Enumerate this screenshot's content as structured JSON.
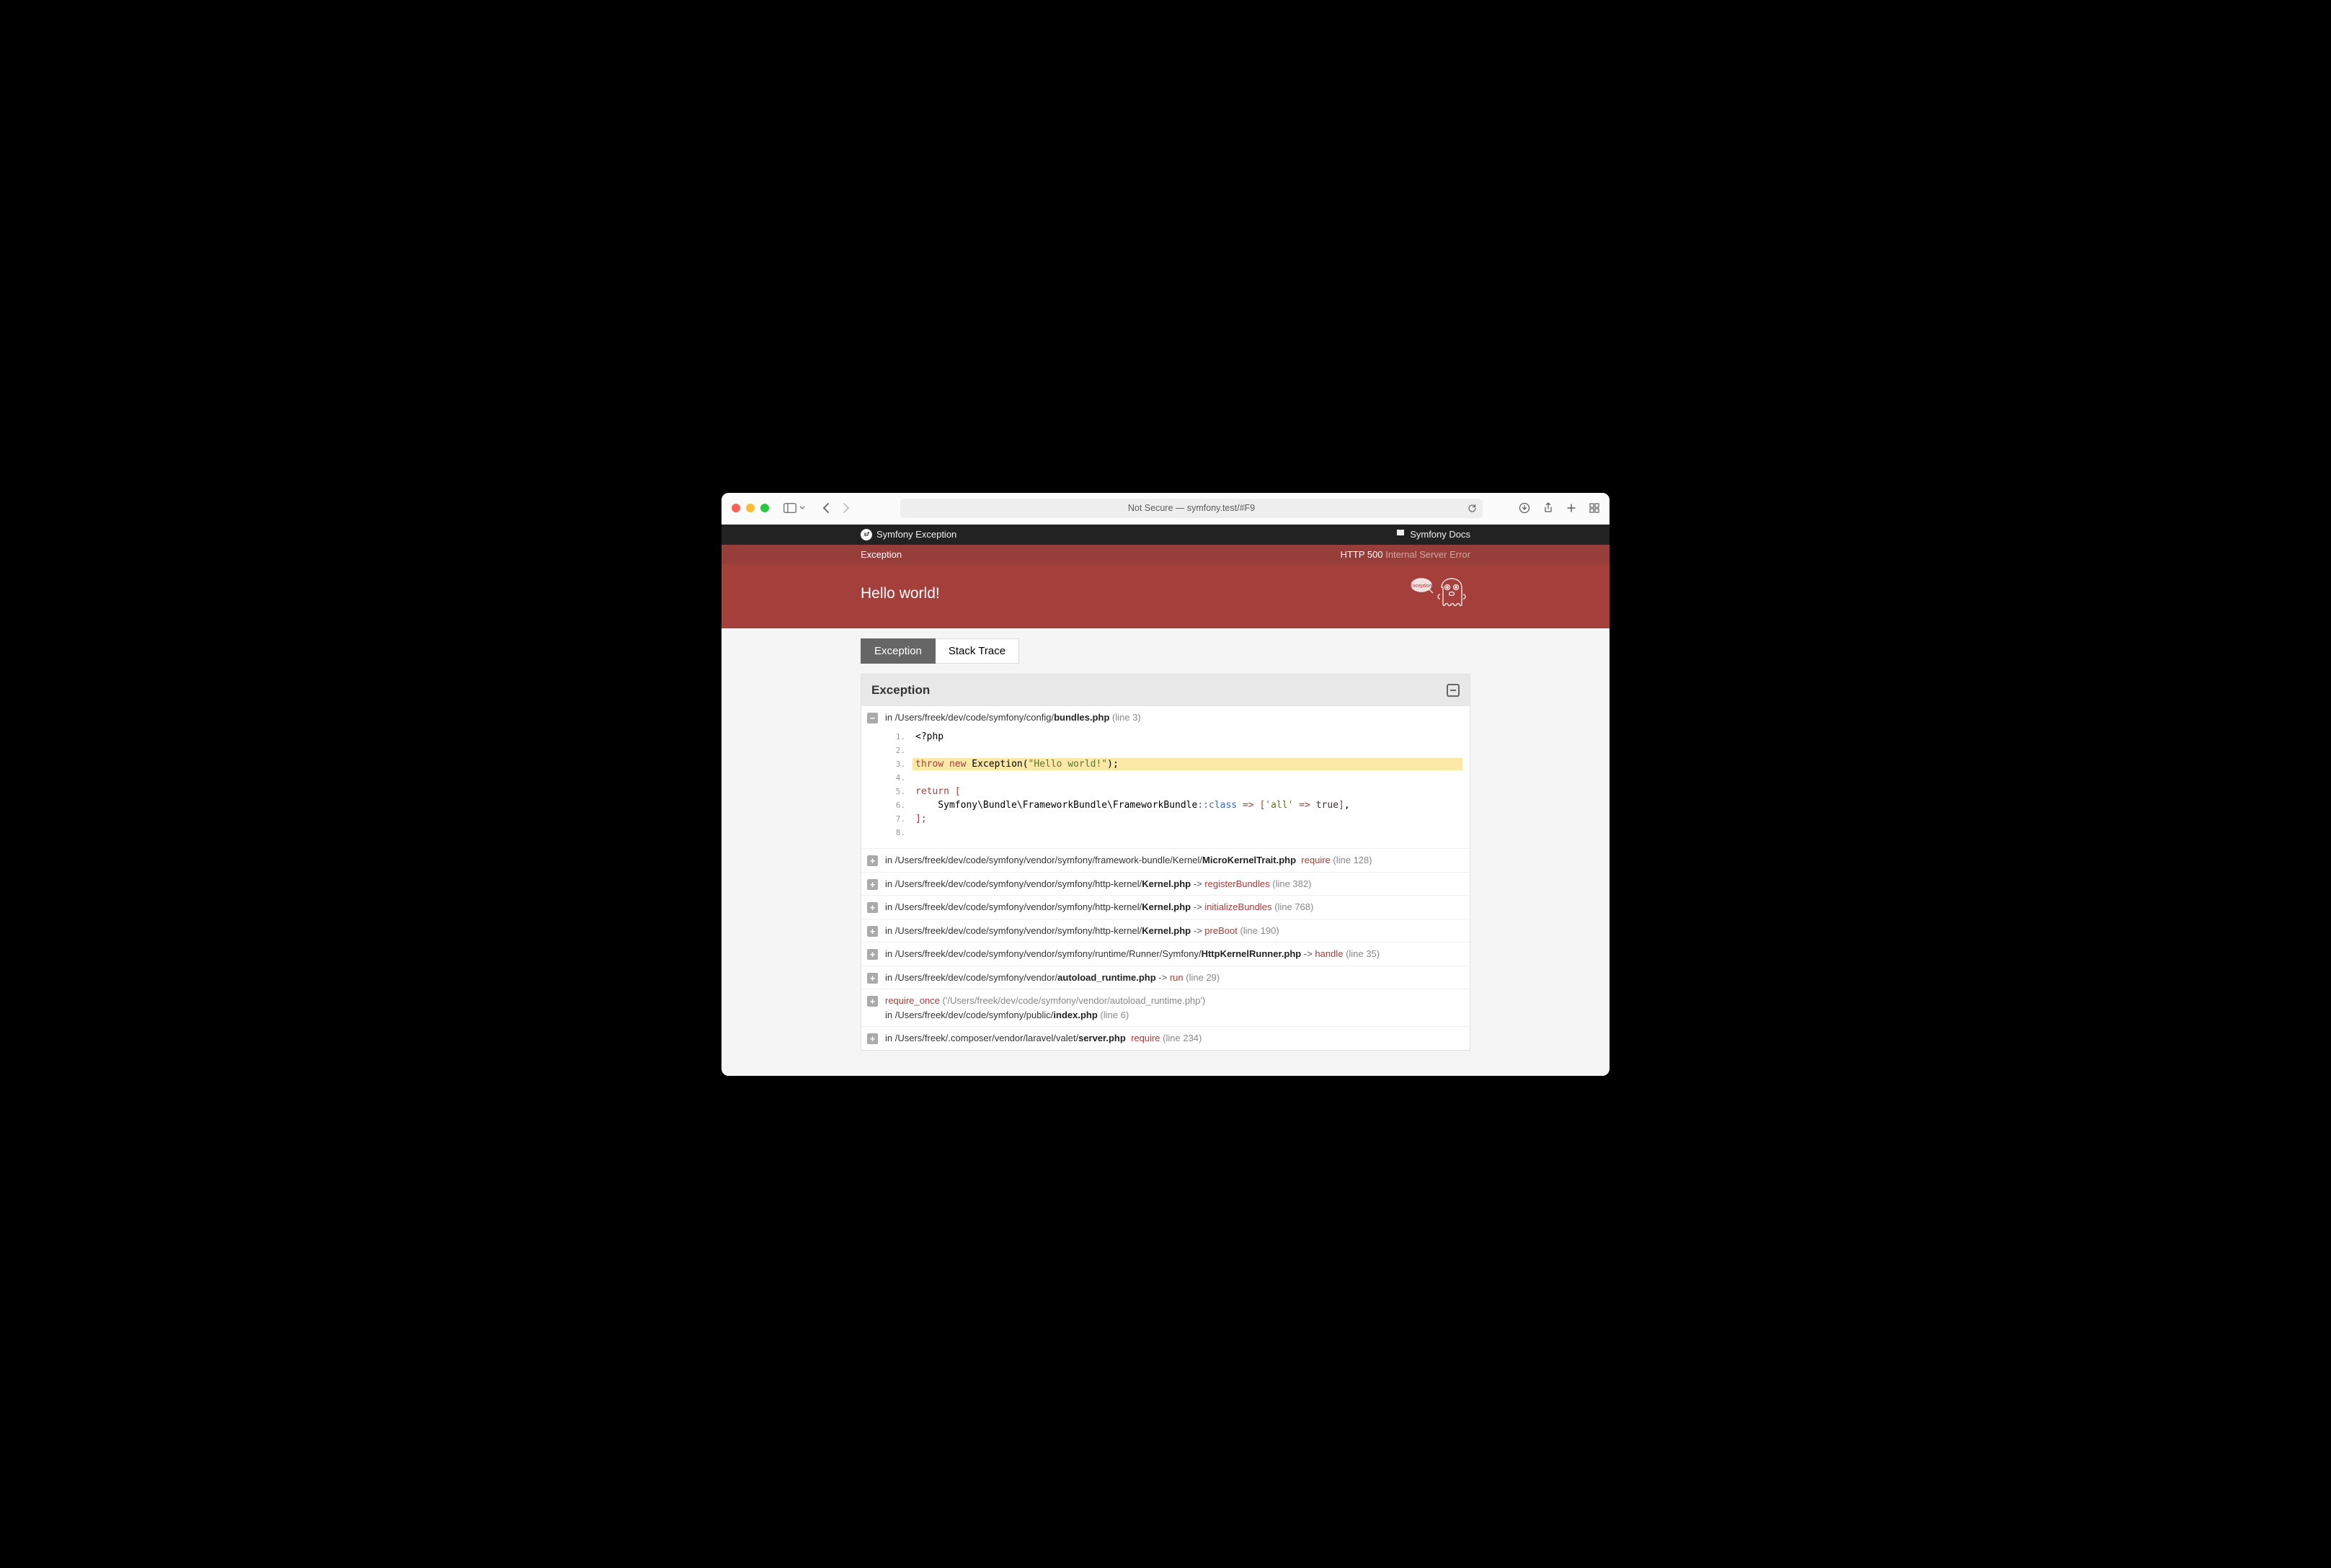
{
  "browser": {
    "addr_prefix": "Not Secure — ",
    "addr": "symfony.test/#F9"
  },
  "topbar": {
    "title": "Symfony Exception",
    "docs": "Symfony Docs"
  },
  "errstrip": {
    "exception": "Exception",
    "http": "HTTP 500",
    "status": "Internal Server Error"
  },
  "hero": {
    "message": "Hello world!"
  },
  "tabs": {
    "exception": "Exception",
    "stack": "Stack Trace"
  },
  "panel": {
    "title": "Exception"
  },
  "frames": [
    {
      "expanded": true,
      "in": "in ",
      "path": "/Users/freek/dev/code/symfony/config/",
      "file": "bundles.php",
      "lineno": "(line 3)",
      "code": {
        "start": 1,
        "lines": [
          {
            "html": "<span>&lt;?php</span>"
          },
          {
            "html": ""
          },
          {
            "hl": true,
            "html": "<span class='k-kw'>throw</span> <span class='k-kw'>new</span> Exception(<span class='k-str'>\"Hello world!\"</span>);"
          },
          {
            "html": ""
          },
          {
            "html": "<span class='k-kw'>return</span> <span class='k-punc'>[</span>"
          },
          {
            "html": "    Symfony\\Bundle\\FrameworkBundle\\FrameworkBundle<span class='k-class'>::class</span> <span class='k-punc'>=&gt;</span> <span class='k-punc'>[</span><span class='k-str'>'all'</span> <span class='k-punc'>=&gt;</span> <span class='k-bool'>true</span><span class='k-punc'>]</span>,"
          },
          {
            "html": "<span class='k-punc'>];</span>"
          },
          {
            "html": ""
          }
        ]
      }
    },
    {
      "in": "in ",
      "path": "/Users/freek/dev/code/symfony/vendor/symfony/framework-bundle/Kernel/",
      "file": "MicroKernelTrait.php",
      "method": "require",
      "lineno": "(line 128)"
    },
    {
      "in": "in ",
      "path": "/Users/freek/dev/code/symfony/vendor/symfony/http-kernel/",
      "file": "Kernel.php",
      "arrow": " -> ",
      "method": "registerBundles",
      "lineno": "(line 382)"
    },
    {
      "in": "in ",
      "path": "/Users/freek/dev/code/symfony/vendor/symfony/http-kernel/",
      "file": "Kernel.php",
      "arrow": " -> ",
      "method": "initializeBundles",
      "lineno": "(line 768)"
    },
    {
      "in": "in ",
      "path": "/Users/freek/dev/code/symfony/vendor/symfony/http-kernel/",
      "file": "Kernel.php",
      "arrow": " -> ",
      "method": "preBoot",
      "lineno": "(line 190)"
    },
    {
      "in": "in ",
      "path": "/Users/freek/dev/code/symfony/vendor/symfony/runtime/Runner/Symfony/",
      "file": "HttpKernelRunner.php",
      "arrow": " -> ",
      "method": "handle",
      "lineno": "(line 35)"
    },
    {
      "in": "in ",
      "path": "/Users/freek/dev/code/symfony/vendor/",
      "file": "autoload_runtime.php",
      "arrow": " -> ",
      "method": "run",
      "lineno": "(line 29)"
    },
    {
      "topmethod": "require_once",
      "topargs": "('/Users/freek/dev/code/symfony/vendor/autoload_runtime.php')",
      "in": "in ",
      "path": "/Users/freek/dev/code/symfony/public/",
      "file": "index.php",
      "lineno": "(line 6)"
    },
    {
      "in": "in ",
      "path": "/Users/freek/.composer/vendor/laravel/valet/",
      "file": "server.php",
      "method": "require",
      "lineno": "(line 234)"
    }
  ]
}
